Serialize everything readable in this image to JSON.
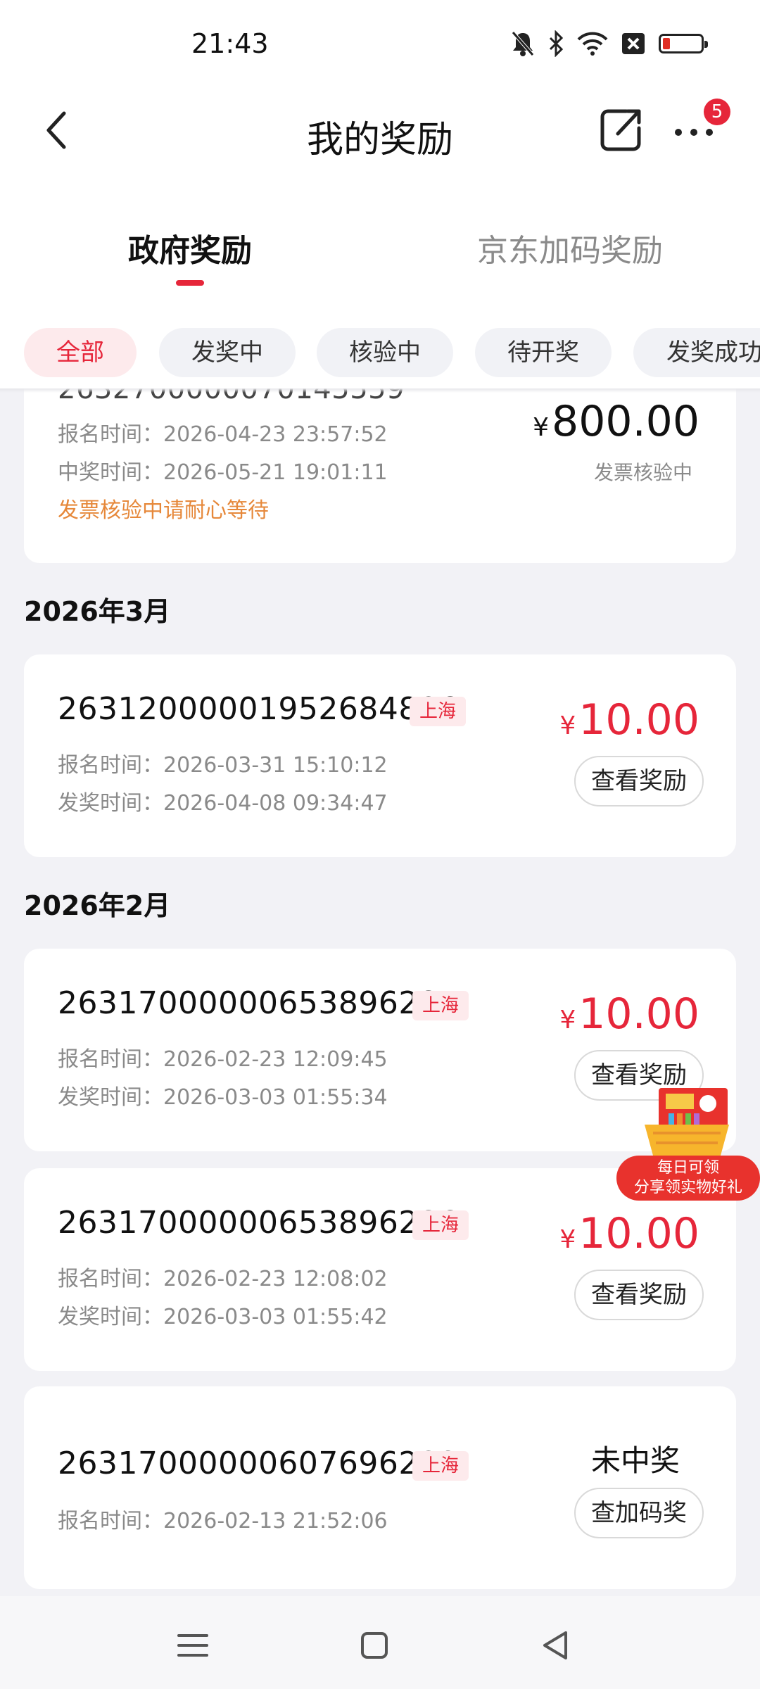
{
  "status_bar": {
    "time": "21:43"
  },
  "header": {
    "title": "我的奖励",
    "more_badge": "5"
  },
  "tabs": [
    {
      "label": "政府奖励",
      "active": true
    },
    {
      "label": "京东加码奖励",
      "active": false
    }
  ],
  "filters": [
    "全部",
    "发奖中",
    "核验中",
    "待开奖",
    "发奖成功"
  ],
  "cards": [
    {
      "signup_label": "报名时间：",
      "signup_time": "2026-04-23 23:57:52",
      "win_label": "中奖时间：",
      "win_time": "2026-05-21 19:01:11",
      "note": "发票核验中请耐心等待",
      "currency": "¥",
      "amount": "800.00",
      "status": "发票核验中"
    }
  ],
  "months": [
    "2026年3月",
    "2026年2月"
  ],
  "records": [
    {
      "order_no": "26312000001952684806",
      "city": "上海",
      "signup_label": "报名时间：",
      "signup_time": "2026-03-31 15:10:12",
      "award_label": "发奖时间：",
      "award_time": "2026-04-08 09:34:47",
      "currency": "¥",
      "amount": "10.00",
      "button": "查看奖励"
    },
    {
      "order_no": "26317000000653896285",
      "city": "上海",
      "signup_label": "报名时间：",
      "signup_time": "2026-02-23 12:09:45",
      "award_label": "发奖时间：",
      "award_time": "2026-03-03 01:55:34",
      "currency": "¥",
      "amount": "10.00",
      "button": "查看奖励"
    },
    {
      "order_no": "26317000000653896286",
      "city": "上海",
      "signup_label": "报名时间：",
      "signup_time": "2026-02-23 12:08:02",
      "award_label": "发奖时间：",
      "award_time": "2026-03-03 01:55:42",
      "currency": "¥",
      "amount": "10.00",
      "button": "查看奖励"
    },
    {
      "order_no": "26317000000607696209",
      "city": "上海",
      "signup_label": "报名时间：",
      "signup_time": "2026-02-13 21:52:06",
      "result": "未中奖",
      "button": "查加码奖"
    }
  ],
  "promo": {
    "line1": "每日可领",
    "line2": "分享领实物好礼"
  },
  "colors": {
    "accent": "#e6263a",
    "warning": "#e6883a",
    "page_bg": "#f2f2f6"
  }
}
